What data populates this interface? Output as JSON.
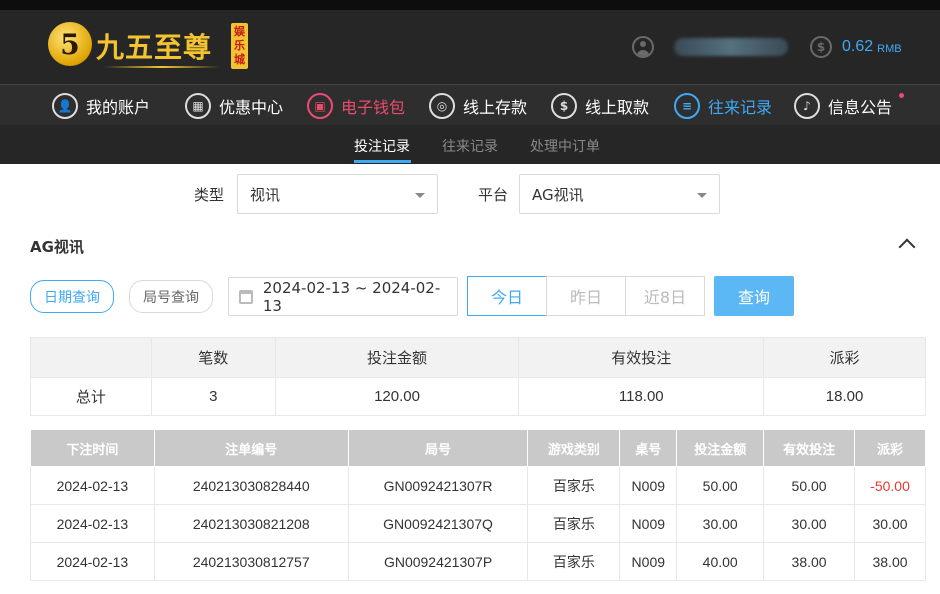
{
  "brand": {
    "logo_glyph": "5",
    "name": "九五至尊",
    "tag": "娱乐城"
  },
  "account": {
    "balance": "0.62",
    "currency": "RMB"
  },
  "nav": {
    "items": [
      {
        "label": "我的账户",
        "icon": "user-icon"
      },
      {
        "label": "优惠中心",
        "icon": "gift-icon"
      },
      {
        "label": "电子钱包",
        "icon": "wallet-icon"
      },
      {
        "label": "线上存款",
        "icon": "deposit-icon"
      },
      {
        "label": "线上取款",
        "icon": "withdraw-icon"
      },
      {
        "label": "往来记录",
        "icon": "records-icon"
      },
      {
        "label": "信息公告",
        "icon": "bell-icon"
      }
    ]
  },
  "subtabs": [
    "投注记录",
    "往来记录",
    "处理中订单"
  ],
  "filters": {
    "type_label": "类型",
    "type_value": "视讯",
    "platform_label": "平台",
    "platform_value": "AG视讯"
  },
  "section": {
    "title": "AG视讯",
    "date_query": "日期查询",
    "round_query": "局号查询",
    "date_range": "2024-02-13 ~ 2024-02-13",
    "today": "今日",
    "yesterday": "昨日",
    "last8": "近8日",
    "query": "查询"
  },
  "summary": {
    "headers": [
      "",
      "笔数",
      "投注金额",
      "有效投注",
      "派彩"
    ],
    "row": [
      "总计",
      "3",
      "120.00",
      "118.00",
      "18.00"
    ]
  },
  "records": {
    "headers": [
      "下注时间",
      "注单编号",
      "局号",
      "游戏类别",
      "桌号",
      "投注金额",
      "有效投注",
      "派彩"
    ],
    "rows": [
      [
        "2024-02-13",
        "240213030828440",
        "GN0092421307R",
        "百家乐",
        "N009",
        "50.00",
        "50.00",
        "-50.00"
      ],
      [
        "2024-02-13",
        "240213030821208",
        "GN0092421307Q",
        "百家乐",
        "N009",
        "30.00",
        "30.00",
        "30.00"
      ],
      [
        "2024-02-13",
        "240213030812757",
        "GN0092421307P",
        "百家乐",
        "N009",
        "40.00",
        "38.00",
        "38.00"
      ]
    ]
  },
  "colors": {
    "accent": "#3fa9f5",
    "pink": "#ec4b6e",
    "gold": "#f4c430",
    "negative": "#e53935"
  }
}
